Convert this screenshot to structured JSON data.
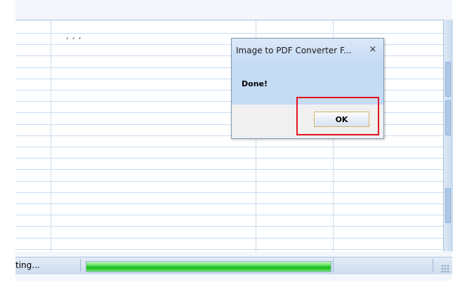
{
  "grid": {
    "header_text": ", , ,"
  },
  "statusbar": {
    "text": "ting...",
    "progress": 1.0
  },
  "dialog": {
    "title": "Image to PDF Converter F...",
    "close_glyph": "×",
    "message": "Done!",
    "ok_label": "OK"
  },
  "colors": {
    "highlight": "#e0141e",
    "progress": "#18b818",
    "dialog_body": "#c6dbf4"
  },
  "icons": {
    "close": "close-icon"
  }
}
